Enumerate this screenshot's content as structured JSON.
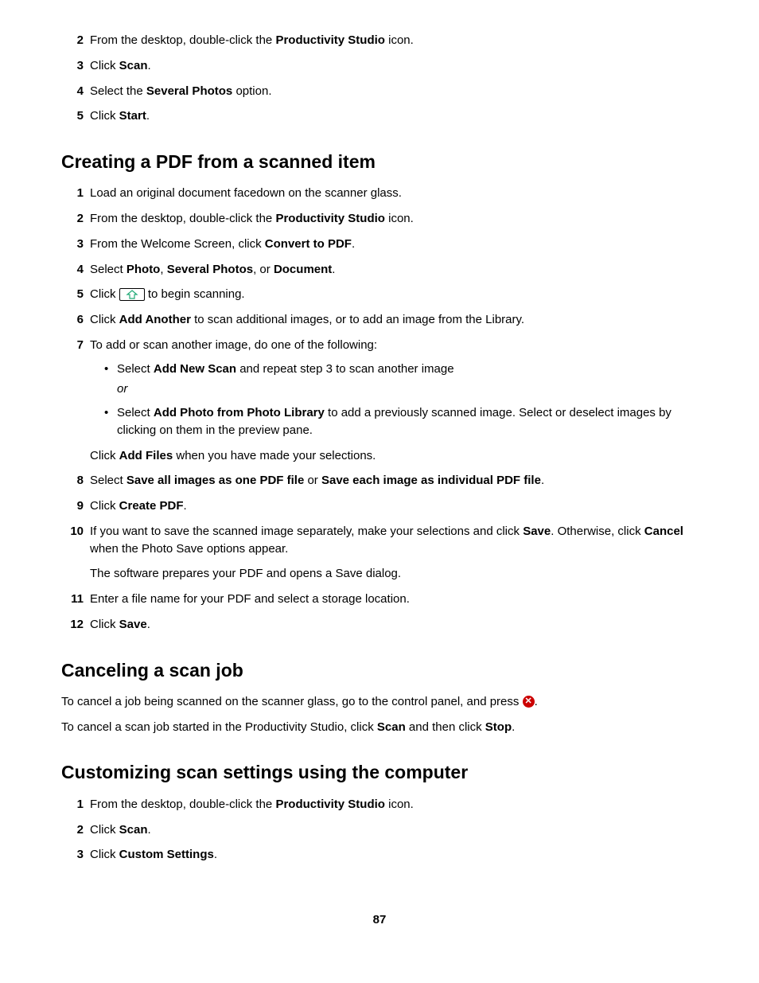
{
  "page_number": "87",
  "intro_steps": [
    {
      "n": "2",
      "pre": "From the desktop, double-click the ",
      "bold": "Productivity Studio",
      "post": " icon."
    },
    {
      "n": "3",
      "pre": "Click ",
      "bold": "Scan",
      "post": "."
    },
    {
      "n": "4",
      "pre": "Select the ",
      "bold": "Several Photos",
      "post": " option."
    },
    {
      "n": "5",
      "pre": "Click ",
      "bold": "Start",
      "post": "."
    }
  ],
  "sec1": {
    "title": "Creating a PDF from a scanned item",
    "s1": {
      "n": "1",
      "text": "Load an original document facedown on the scanner glass."
    },
    "s2": {
      "n": "2",
      "pre": "From the desktop, double-click the ",
      "bold": "Productivity Studio",
      "post": " icon."
    },
    "s3": {
      "n": "3",
      "pre": "From the Welcome Screen, click ",
      "bold": "Convert to PDF",
      "post": "."
    },
    "s4": {
      "n": "4",
      "pre": "Select ",
      "b1": "Photo",
      "sep1": ", ",
      "b2": "Several Photos",
      "sep2": ", or ",
      "b3": "Document",
      "post": "."
    },
    "s5": {
      "n": "5",
      "pre": "Click ",
      "post": " to begin scanning."
    },
    "s6": {
      "n": "6",
      "pre": "Click ",
      "bold": "Add Another",
      "post": " to scan additional images, or to add an image from the Library."
    },
    "s7": {
      "n": "7",
      "text": "To add or scan another image, do one of the following:",
      "b1": {
        "pre": "Select ",
        "bold": "Add New Scan",
        "post": " and repeat step 3 to scan another image",
        "or": "or"
      },
      "b2": {
        "pre": "Select ",
        "bold": "Add Photo from Photo Library",
        "post": " to add a previously scanned image. Select or deselect images by clicking on them in the preview pane."
      },
      "follow": {
        "pre": "Click ",
        "bold": "Add Files",
        "post": " when you have made your selections."
      }
    },
    "s8": {
      "n": "8",
      "pre": "Select ",
      "b1": "Save all images as one PDF file",
      "mid": " or ",
      "b2": "Save each image as individual PDF file",
      "post": "."
    },
    "s9": {
      "n": "9",
      "pre": "Click ",
      "bold": "Create PDF",
      "post": "."
    },
    "s10": {
      "n": "10",
      "pre": "If you want to save the scanned image separately, make your selections and click ",
      "b1": "Save",
      "mid": ". Otherwise, click ",
      "b2": "Cancel",
      "post": " when the Photo Save options appear.",
      "follow": "The software prepares your PDF and opens a Save dialog."
    },
    "s11": {
      "n": "11",
      "text": "Enter a file name for your PDF and select a storage location."
    },
    "s12": {
      "n": "12",
      "pre": "Click ",
      "bold": "Save",
      "post": "."
    }
  },
  "sec2": {
    "title": "Canceling a scan job",
    "p1": {
      "pre": "To cancel a job being scanned on the scanner glass, go to the control panel, and press ",
      "post": "."
    },
    "p2": {
      "pre": "To cancel a scan job started in the Productivity Studio, click ",
      "b1": "Scan",
      "mid": " and then click ",
      "b2": "Stop",
      "post": "."
    }
  },
  "sec3": {
    "title": "Customizing scan settings using the computer",
    "s1": {
      "n": "1",
      "pre": "From the desktop, double-click the ",
      "bold": "Productivity Studio",
      "post": " icon."
    },
    "s2": {
      "n": "2",
      "pre": "Click ",
      "bold": "Scan",
      "post": "."
    },
    "s3": {
      "n": "3",
      "pre": "Click ",
      "bold": "Custom Settings",
      "post": "."
    }
  }
}
